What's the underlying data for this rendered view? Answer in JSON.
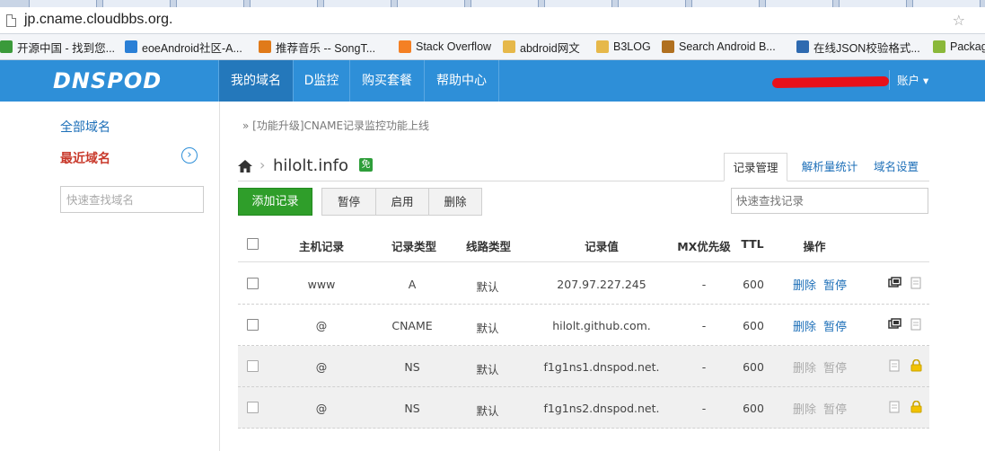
{
  "browser": {
    "url": "jp.cname.cloudbbs.org.",
    "bookmarks": [
      {
        "label": "开源中国 - 找到您...",
        "icon": "osc-icon",
        "color": "#3a9a3a"
      },
      {
        "label": "eoeAndroid社区-A...",
        "icon": "eoe-icon",
        "color": "#2a7fd6"
      },
      {
        "label": "推荐音乐 -- SongT...",
        "icon": "songtaste-icon",
        "color": "#e07a1a"
      },
      {
        "label": "Stack Overflow",
        "icon": "stackoverflow-icon",
        "color": "#f48024"
      },
      {
        "label": "abdroid网文",
        "icon": "folder-icon",
        "color": "#e6b84a"
      },
      {
        "label": "B3LOG",
        "icon": "folder-icon",
        "color": "#e6b84a"
      },
      {
        "label": "Search Android B...",
        "icon": "search-android-icon",
        "color": "#b07020"
      },
      {
        "label": "在线JSON校验格式...",
        "icon": "json-icon",
        "color": "#2e6ab0"
      },
      {
        "label": "Packag",
        "icon": "android-icon",
        "color": "#8ab83a"
      }
    ]
  },
  "header": {
    "logo": "DNSPOD",
    "nav": [
      "我的域名",
      "D监控",
      "购买套餐",
      "帮助中心"
    ],
    "account": "账户 ▾",
    "brand_color": "#2e8fd8"
  },
  "sidebar": {
    "all_domains": "全部域名",
    "recent_domains": "最近域名",
    "arrow": "›",
    "search_placeholder": "快速查找域名"
  },
  "main": {
    "notice": "» [功能升级]CNAME记录监控功能上线",
    "domain": "hilolt.info",
    "free_badge": "免",
    "tabs": [
      "记录管理",
      "解析量统计",
      "域名设置"
    ],
    "add_button": "添加记录",
    "actions": [
      "暂停",
      "启用",
      "删除"
    ],
    "record_search_placeholder": "快速查找记录",
    "columns": [
      "主机记录",
      "记录类型",
      "线路类型",
      "记录值",
      "MX优先级",
      "TTL",
      "操作"
    ],
    "records": [
      {
        "host": "www",
        "type": "A",
        "line": "默认",
        "value": "207.97.227.245",
        "mx": "-",
        "ttl": "600",
        "del": "删除",
        "pause": "暂停",
        "locked": false
      },
      {
        "host": "@",
        "type": "CNAME",
        "line": "默认",
        "value": "hilolt.github.com.",
        "mx": "-",
        "ttl": "600",
        "del": "删除",
        "pause": "暂停",
        "locked": false
      },
      {
        "host": "@",
        "type": "NS",
        "line": "默认",
        "value": "f1g1ns1.dnspod.net.",
        "mx": "-",
        "ttl": "600",
        "del": "删除",
        "pause": "暂停",
        "locked": true
      },
      {
        "host": "@",
        "type": "NS",
        "line": "默认",
        "value": "f1g1ns2.dnspod.net.",
        "mx": "-",
        "ttl": "600",
        "del": "删除",
        "pause": "暂停",
        "locked": true
      }
    ]
  }
}
